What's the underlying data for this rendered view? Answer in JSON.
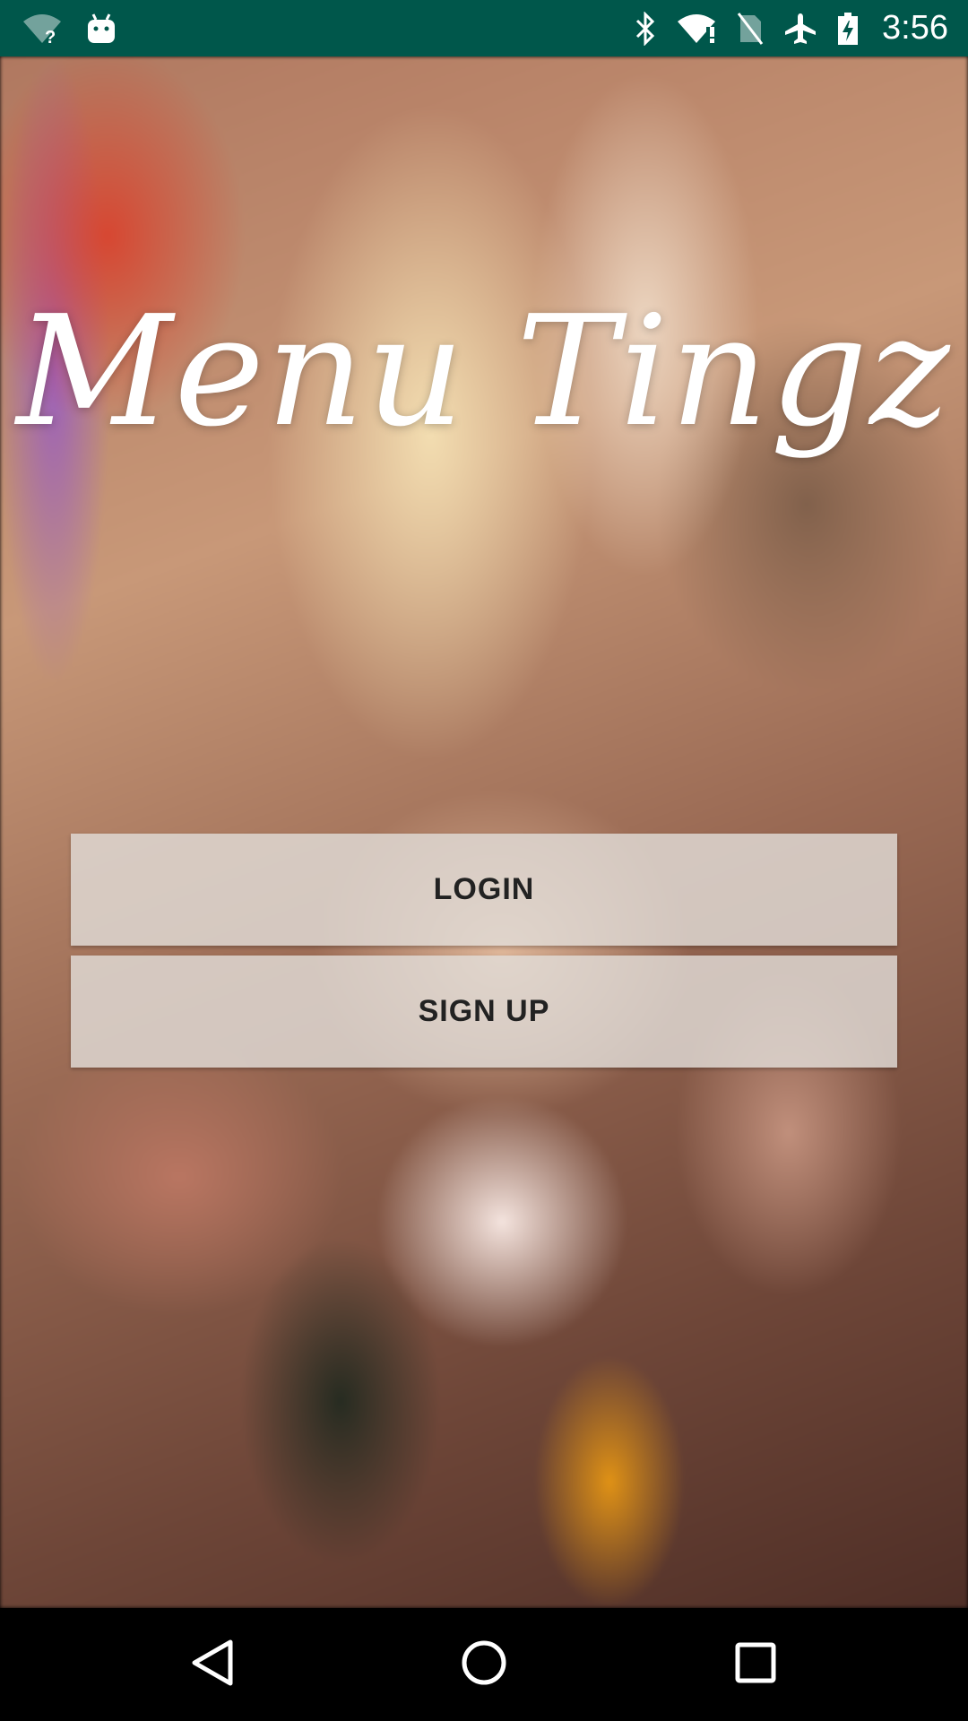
{
  "status_bar": {
    "time": "3:56",
    "background_color": "#00574b",
    "icons_left": [
      "wifi-unknown-icon",
      "android-debug-icon"
    ],
    "icons_right": [
      "bluetooth-icon",
      "wifi-alert-icon",
      "no-sim-icon",
      "airplane-mode-icon",
      "battery-charging-icon"
    ]
  },
  "app": {
    "logo_text": "Menu Tingz"
  },
  "buttons": {
    "login_label": "LOGIN",
    "signup_label": "SIGN UP"
  },
  "navigation_bar": {
    "icons": [
      "back-icon",
      "home-icon",
      "recents-icon"
    ]
  }
}
